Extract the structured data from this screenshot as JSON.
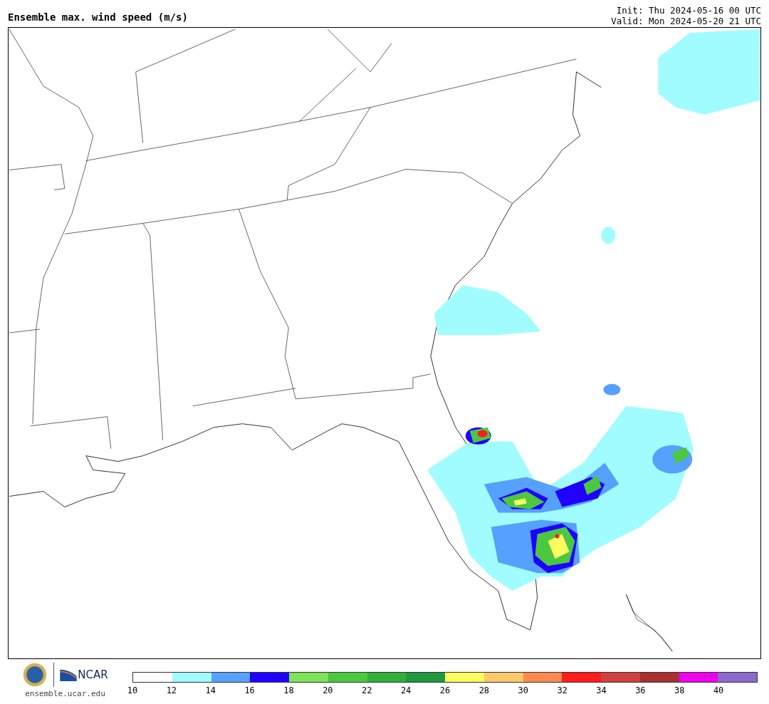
{
  "header": {
    "title": "Ensemble max. wind speed (m/s)",
    "init": "Init: Thu 2024-05-16 00 UTC",
    "valid": "Valid: Mon 2024-05-20 21 UTC"
  },
  "footer": {
    "logo_text": "NCAR",
    "url": "ensemble.ucar.edu"
  },
  "legend": {
    "segments": [
      {
        "color": "#ffffff"
      },
      {
        "color": "#a0fcff"
      },
      {
        "color": "#56a0ff"
      },
      {
        "color": "#2000ff"
      },
      {
        "color": "#7ee25a"
      },
      {
        "color": "#4cc840"
      },
      {
        "color": "#30b03a"
      },
      {
        "color": "#209840"
      },
      {
        "color": "#fffc60"
      },
      {
        "color": "#ffc868"
      },
      {
        "color": "#ff8a50"
      },
      {
        "color": "#ff1c1c"
      },
      {
        "color": "#d04040"
      },
      {
        "color": "#a83030"
      },
      {
        "color": "#ec00ec"
      },
      {
        "color": "#8c68cc"
      }
    ],
    "ticks": [
      "10",
      "12",
      "14",
      "16",
      "18",
      "20",
      "22",
      "24",
      "26",
      "28",
      "30",
      "32",
      "34",
      "36",
      "38",
      "40"
    ]
  }
}
